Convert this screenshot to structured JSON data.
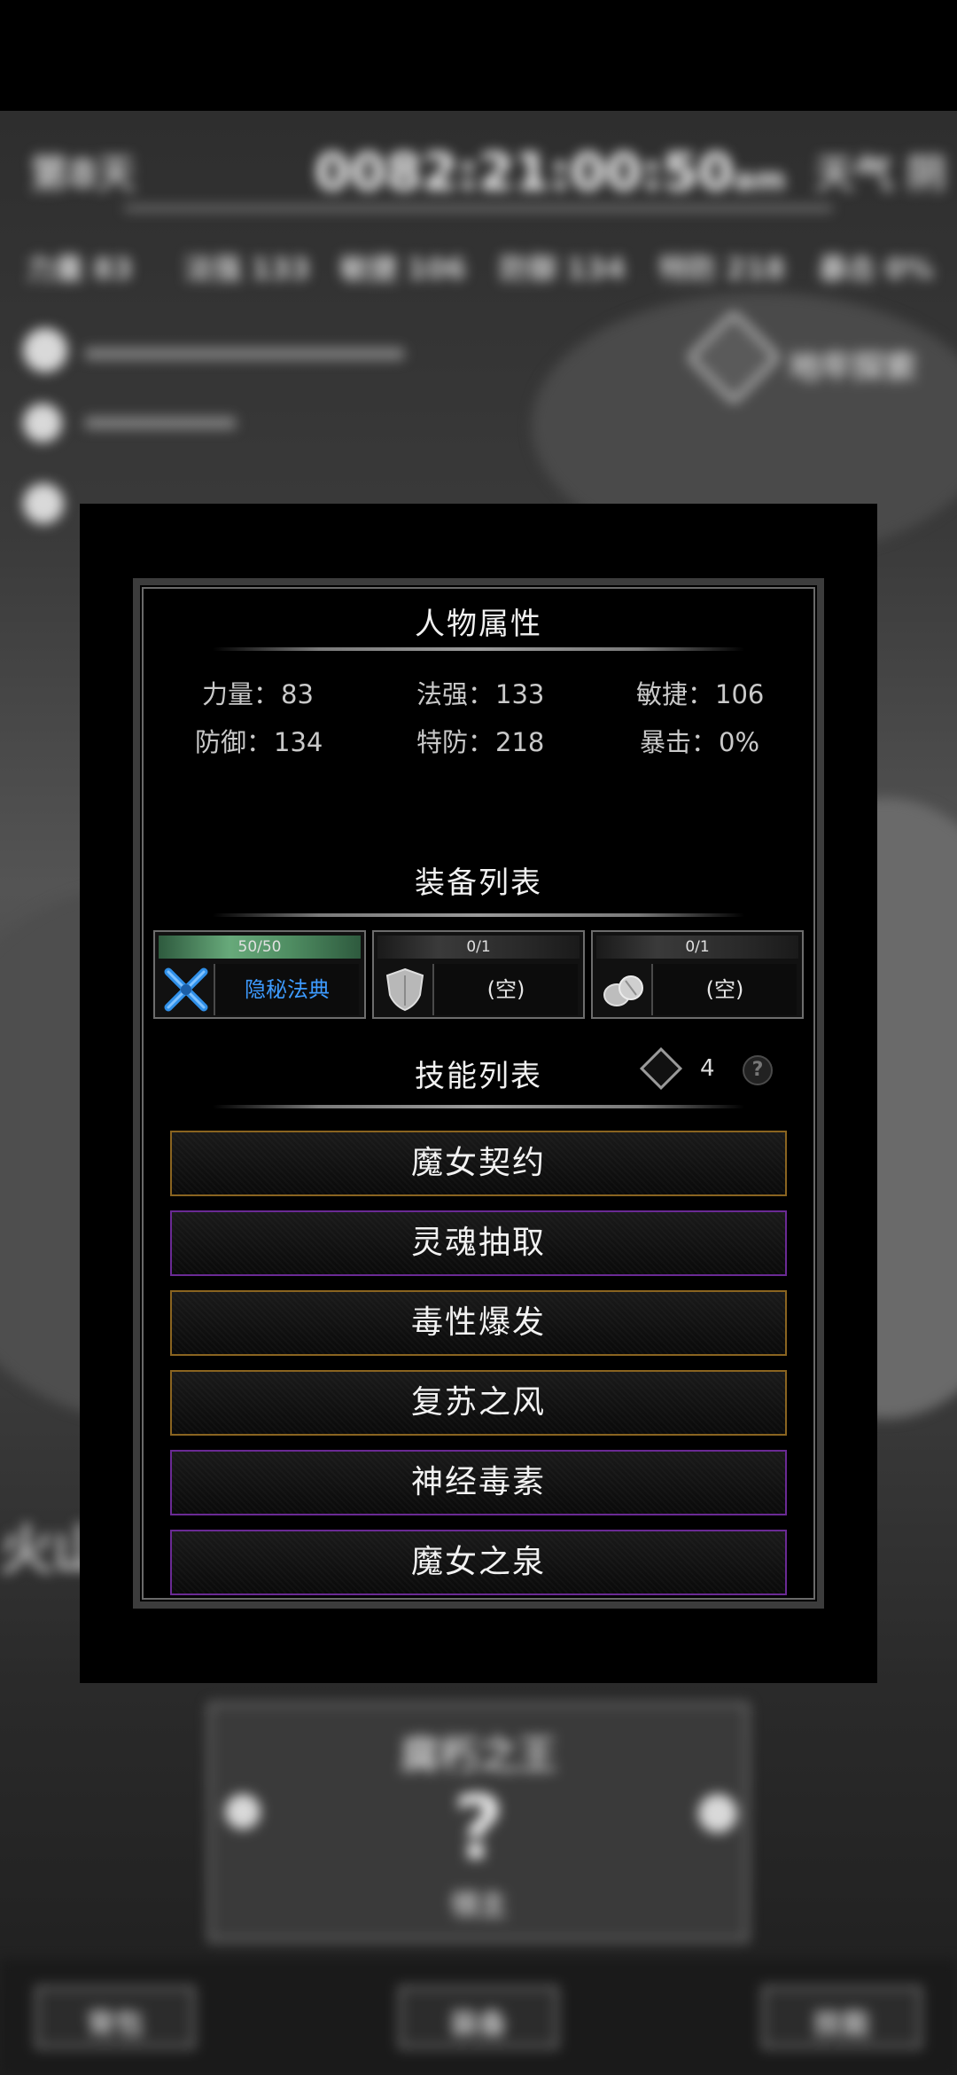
{
  "background": {
    "day_label": "第8天",
    "clock": "0082:21:00:50",
    "clock_suffix": "am",
    "weather": "天气 阴",
    "stats_row": [
      "力量 83",
      "法强 133",
      "敏捷 106",
      "防御 134",
      "特防 218",
      "暴击 0%"
    ],
    "dungeon_label": "地牢探索",
    "left_text": "火山",
    "card_title": "腐朽之王",
    "card_sub": "领主",
    "buttons": [
      "背包",
      "装备",
      "技能"
    ]
  },
  "attributes": {
    "title": "人物属性",
    "stats": [
      {
        "label": "力量：",
        "value": "83"
      },
      {
        "label": "法强：",
        "value": "133"
      },
      {
        "label": "敏捷：",
        "value": "106"
      },
      {
        "label": "防御：",
        "value": "134"
      },
      {
        "label": "特防：",
        "value": "218"
      },
      {
        "label": "暴击：",
        "value": "0%"
      }
    ]
  },
  "equipment": {
    "title": "装备列表",
    "slots": [
      {
        "counter": "50/50",
        "name": "隐秘法典",
        "icon": "crossed-swords-icon"
      },
      {
        "counter": "0/1",
        "name": "(空)",
        "icon": "shield-icon"
      },
      {
        "counter": "0/1",
        "name": "(空)",
        "icon": "stones-icon"
      }
    ]
  },
  "skills": {
    "title": "技能列表",
    "points": "4",
    "help": "?",
    "items": [
      {
        "name": "魔女契约",
        "rarity": "gold"
      },
      {
        "name": "灵魂抽取",
        "rarity": "purple"
      },
      {
        "name": "毒性爆发",
        "rarity": "gold"
      },
      {
        "name": "复苏之风",
        "rarity": "gold"
      },
      {
        "name": "神经毒素",
        "rarity": "purple"
      },
      {
        "name": "魔女之泉",
        "rarity": "purple"
      }
    ]
  },
  "colors": {
    "gold_border": "#8a6420",
    "purple_border": "#6a2a94",
    "equip_name_blue": "#3d9bff",
    "hp_bar": "#67a97a"
  }
}
